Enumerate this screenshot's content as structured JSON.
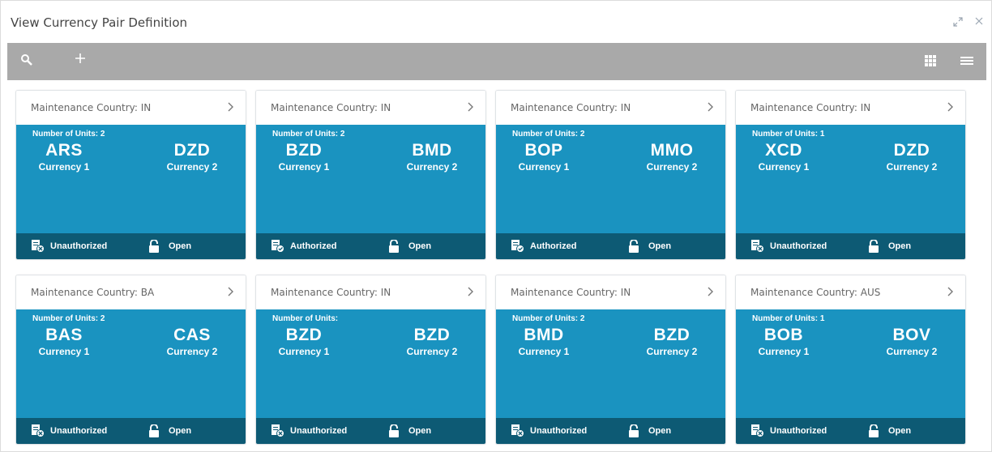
{
  "window": {
    "title": "View Currency Pair Definition",
    "controls": [
      "minimize-icon",
      "close-icon"
    ]
  },
  "toolbar": {
    "icons": [
      "search-icon",
      "add-icon",
      "grid-view-icon",
      "list-view-icon"
    ]
  },
  "colors": {
    "toolbar": "#a9a9a9",
    "card_body": "#1a93c0",
    "card_footer": "#0d5a74"
  },
  "cards": [
    {
      "country": "Maintenance Country:  IN",
      "units": "Number of Units:  2",
      "currency1": "ARS",
      "currency1_label": "Currency 1",
      "currency2": "DZD",
      "currency2_label": "Currency 2",
      "status": "Unauthorized",
      "status_icon": "unauthorized-icon",
      "lock": "Open"
    },
    {
      "country": "Maintenance Country:  IN",
      "units": "Number of Units:  2",
      "currency1": "BZD",
      "currency1_label": "Currency 1",
      "currency2": "BMD",
      "currency2_label": "Currency 2",
      "status": "Authorized",
      "status_icon": "authorized-icon",
      "lock": "Open"
    },
    {
      "country": "Maintenance Country:  IN",
      "units": "Number of Units:  2",
      "currency1": "BOP",
      "currency1_label": "Currency 1",
      "currency2": "MMO",
      "currency2_label": "Currency 2",
      "status": "Authorized",
      "status_icon": "authorized-icon",
      "lock": "Open"
    },
    {
      "country": "Maintenance Country:  IN",
      "units": "Number of Units:  1",
      "currency1": "XCD",
      "currency1_label": "Currency 1",
      "currency2": "DZD",
      "currency2_label": "Currency 2",
      "status": "Unauthorized",
      "status_icon": "unauthorized-icon",
      "lock": "Open"
    },
    {
      "country": "Maintenance Country:  BA",
      "units": "Number of Units:  2",
      "currency1": "BAS",
      "currency1_label": "Currency 1",
      "currency2": "CAS",
      "currency2_label": "Currency 2",
      "status": "Unauthorized",
      "status_icon": "unauthorized-icon",
      "lock": "Open"
    },
    {
      "country": "Maintenance Country:  IN",
      "units": "Number of Units:",
      "currency1": "BZD",
      "currency1_label": "Currency 1",
      "currency2": "BZD",
      "currency2_label": "Currency 2",
      "status": "Unauthorized",
      "status_icon": "unauthorized-icon",
      "lock": "Open"
    },
    {
      "country": "Maintenance Country:  IN",
      "units": "Number of Units:  2",
      "currency1": "BMD",
      "currency1_label": "Currency 1",
      "currency2": "BZD",
      "currency2_label": "Currency 2",
      "status": "Unauthorized",
      "status_icon": "unauthorized-icon",
      "lock": "Open"
    },
    {
      "country": "Maintenance Country:  AUS",
      "units": "Number of Units:  1",
      "currency1": "BOB",
      "currency1_label": "Currency 1",
      "currency2": "BOV",
      "currency2_label": "Currency 2",
      "status": "Unauthorized",
      "status_icon": "unauthorized-icon",
      "lock": "Open"
    }
  ]
}
